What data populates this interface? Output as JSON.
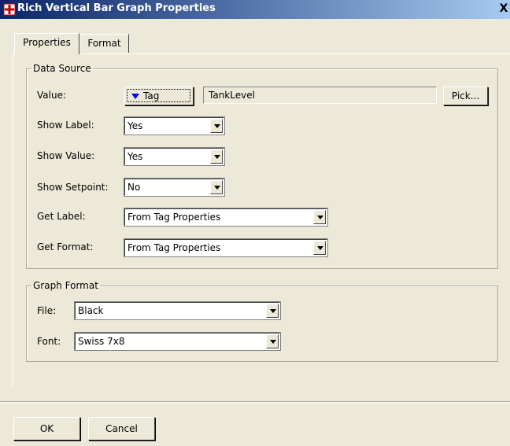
{
  "window": {
    "title": "Rich Vertical Bar Graph Properties",
    "close_symbol": "X"
  },
  "tabs": [
    {
      "label": "Properties"
    },
    {
      "label": "Format"
    }
  ],
  "data_source": {
    "legend": "Data Source",
    "value_label": "Value:",
    "tag_button_label": "Tag",
    "tag_value": "TankLevel",
    "pick_button_label": "Pick...",
    "show_label": {
      "label": "Show Label:",
      "value": "Yes"
    },
    "show_value": {
      "label": "Show Value:",
      "value": "Yes"
    },
    "show_setpoint": {
      "label": "Show Setpoint:",
      "value": "No"
    },
    "get_label": {
      "label": "Get Label:",
      "value": "From Tag Properties"
    },
    "get_format": {
      "label": "Get Format:",
      "value": "From Tag Properties"
    }
  },
  "graph_format": {
    "legend": "Graph Format",
    "file": {
      "label": "File:",
      "value": "Black"
    },
    "font": {
      "label": "Font:",
      "value": "Swiss 7x8"
    }
  },
  "buttons": {
    "ok": "OK",
    "cancel": "Cancel"
  },
  "colors": {
    "title_start": "#0a246a",
    "title_end": "#a6caf0",
    "face": "#ece9d8",
    "tag_arrow": "#0000ff"
  }
}
